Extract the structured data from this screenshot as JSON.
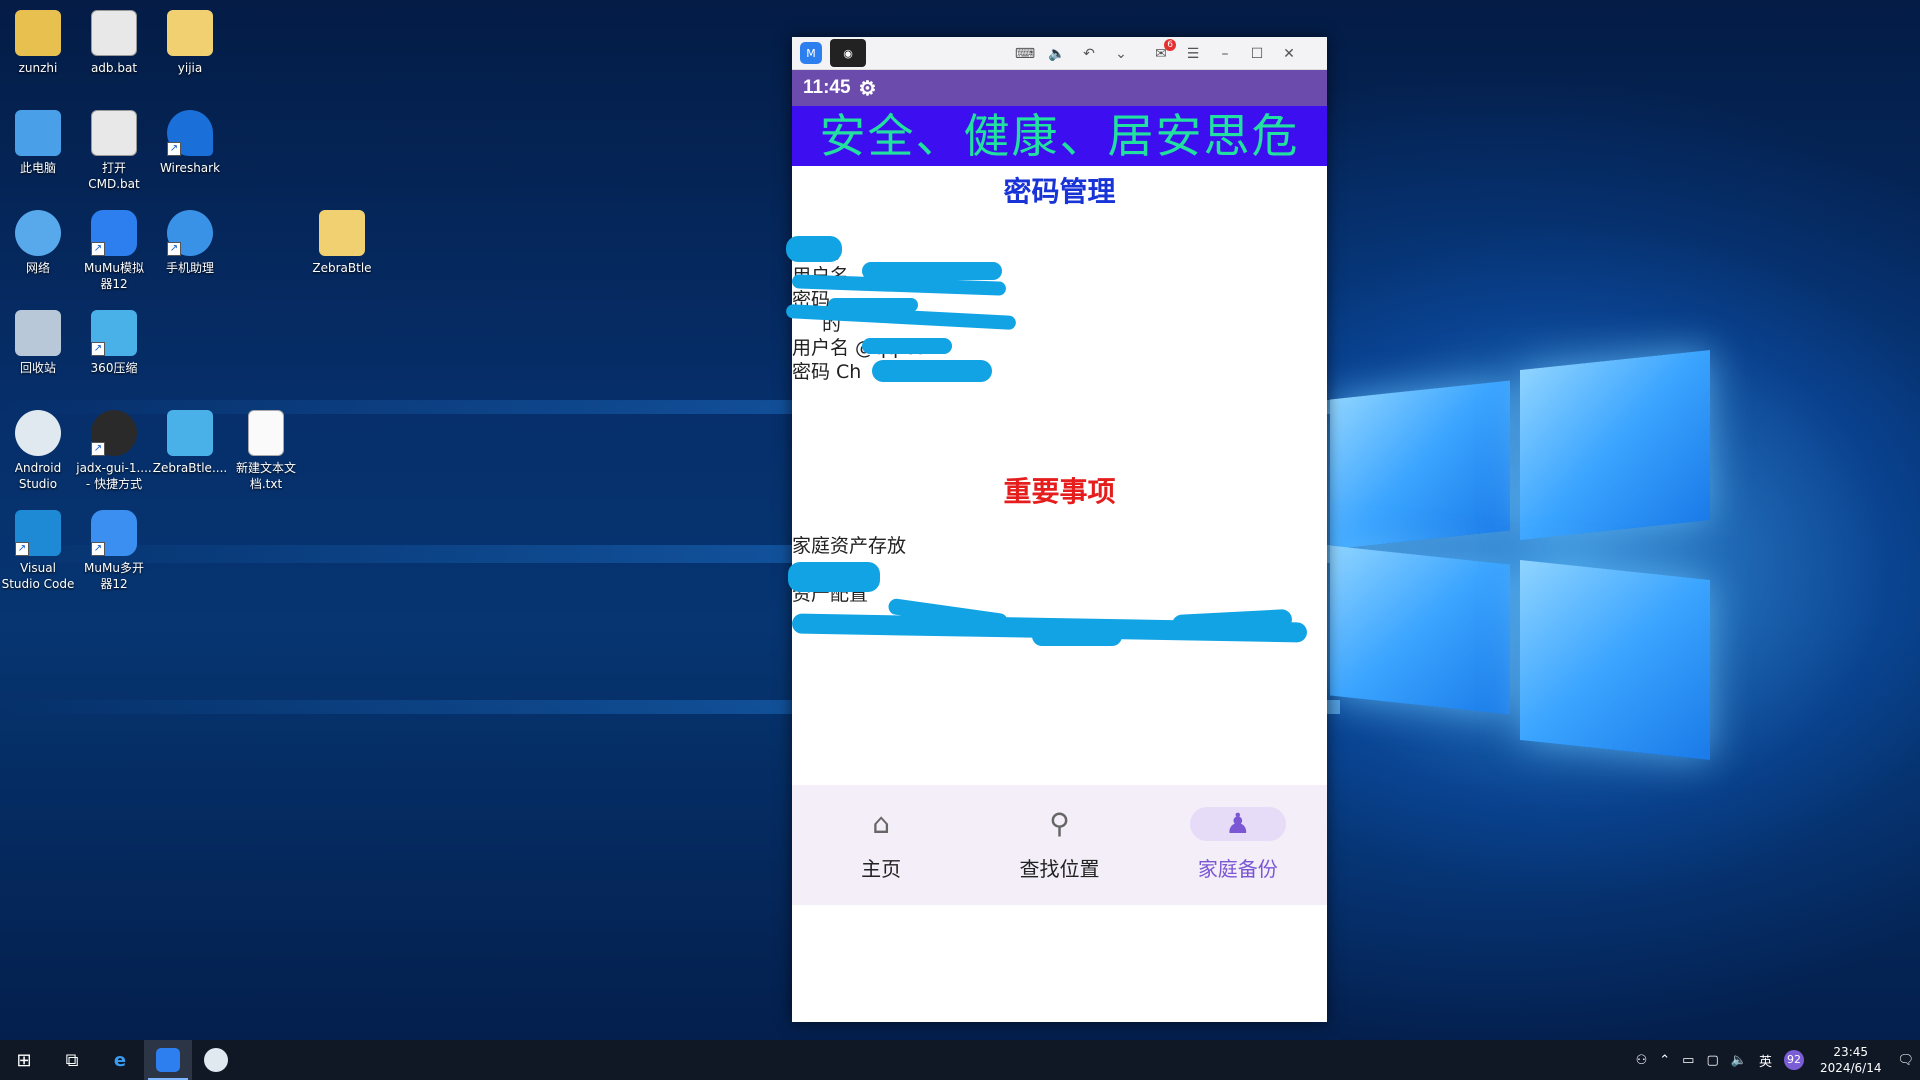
{
  "desktop": {
    "icons": [
      {
        "label": "zunzhi",
        "icon": "user-folder-icon"
      },
      {
        "label": "adb.bat",
        "icon": "batch-file-icon"
      },
      {
        "label": "yijia",
        "icon": "folder-icon"
      },
      {
        "label": "此电脑",
        "icon": "this-pc-icon"
      },
      {
        "label": "打开\nCMD.bat",
        "icon": "batch-file-icon"
      },
      {
        "label": "Wireshark",
        "icon": "wireshark-icon"
      },
      {
        "label": "网络",
        "icon": "network-icon"
      },
      {
        "label": "MuMu模拟\n器12",
        "icon": "mumu-icon"
      },
      {
        "label": "手机助理",
        "icon": "phone-assistant-icon"
      },
      {
        "label": "ZebraBtle",
        "icon": "folder-icon"
      },
      {
        "label": "回收站",
        "icon": "recycle-bin-icon"
      },
      {
        "label": "360压缩",
        "icon": "archive-icon"
      },
      {
        "label": "Android\nStudio",
        "icon": "android-studio-icon"
      },
      {
        "label": "jadx-gui-1....\n- 快捷方式",
        "icon": "jadx-icon"
      },
      {
        "label": "ZebraBtle....",
        "icon": "archive-icon"
      },
      {
        "label": "新建文本文\n档.txt",
        "icon": "text-file-icon"
      },
      {
        "label": "Visual\nStudio Code",
        "icon": "vscode-icon"
      },
      {
        "label": "MuMu多开\n器12",
        "icon": "mumu-multi-icon"
      }
    ]
  },
  "emulator": {
    "badge_count": "6",
    "status_time": "11:45",
    "banner": "安全、健康、居安思危",
    "password_section": {
      "title": "密码管理",
      "lines": [
        "的",
        "用户名 ",
        "密码",
        "的",
        "用户名 @qq.com",
        "密码 Ch"
      ]
    },
    "important_section": {
      "title": "重要事项",
      "lines": [
        "家庭资产存放",
        "",
        "资产配置",
        ""
      ]
    },
    "nav": [
      {
        "label": "主页",
        "icon": "home-icon",
        "active": false
      },
      {
        "label": "查找位置",
        "icon": "search-icon",
        "active": false
      },
      {
        "label": "家庭备份",
        "icon": "family-icon",
        "active": true
      }
    ]
  },
  "taskbar": {
    "time": "23:45",
    "date": "2024/6/14",
    "ime": "英",
    "notification_badge": "92"
  }
}
